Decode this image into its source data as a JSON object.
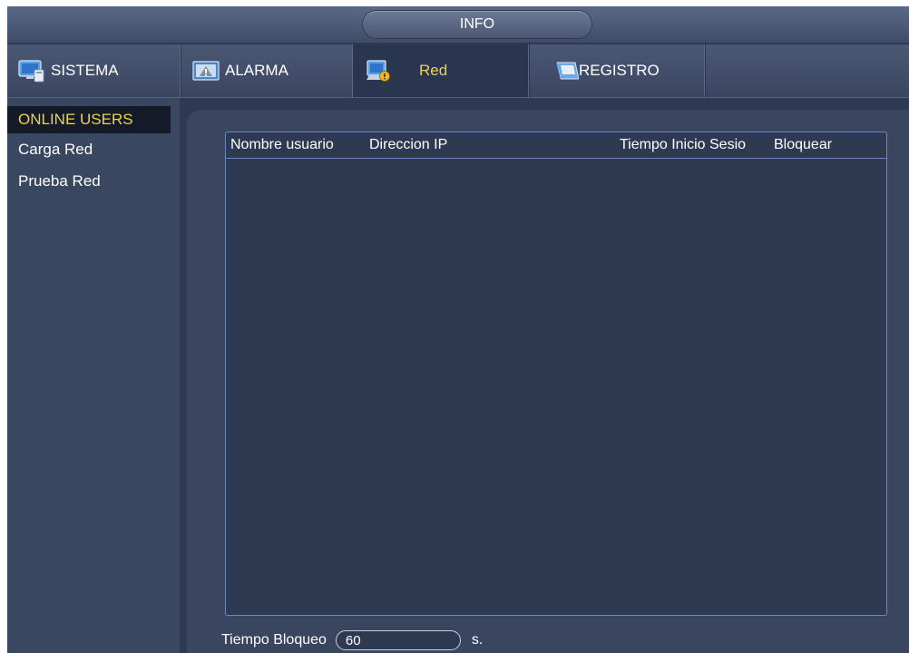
{
  "title": "INFO",
  "tabs": [
    {
      "label": "SISTEMA",
      "icon": "system-monitor-icon",
      "active": false
    },
    {
      "label": "ALARMA",
      "icon": "alarm-icon",
      "active": false
    },
    {
      "label": "Red",
      "icon": "network-info-icon",
      "active": true
    },
    {
      "label": "REGISTRO",
      "icon": "log-book-icon",
      "active": false
    }
  ],
  "sidebar": {
    "items": [
      {
        "label": "ONLINE USERS",
        "active": true
      },
      {
        "label": "Carga Red",
        "active": false
      },
      {
        "label": "Prueba Red",
        "active": false
      }
    ]
  },
  "table": {
    "columns": [
      "Nombre usuario",
      "Direccion IP",
      "Tiempo Inicio Sesio",
      "Bloquear"
    ],
    "rows": []
  },
  "footer": {
    "lock_time_label": "Tiempo Bloqueo",
    "lock_time_value": "60",
    "unit": "s."
  },
  "colors": {
    "accent": "#f0d24a",
    "background": "#2e3a52",
    "panel": "#3a4660",
    "table_border": "#6c86c4"
  }
}
